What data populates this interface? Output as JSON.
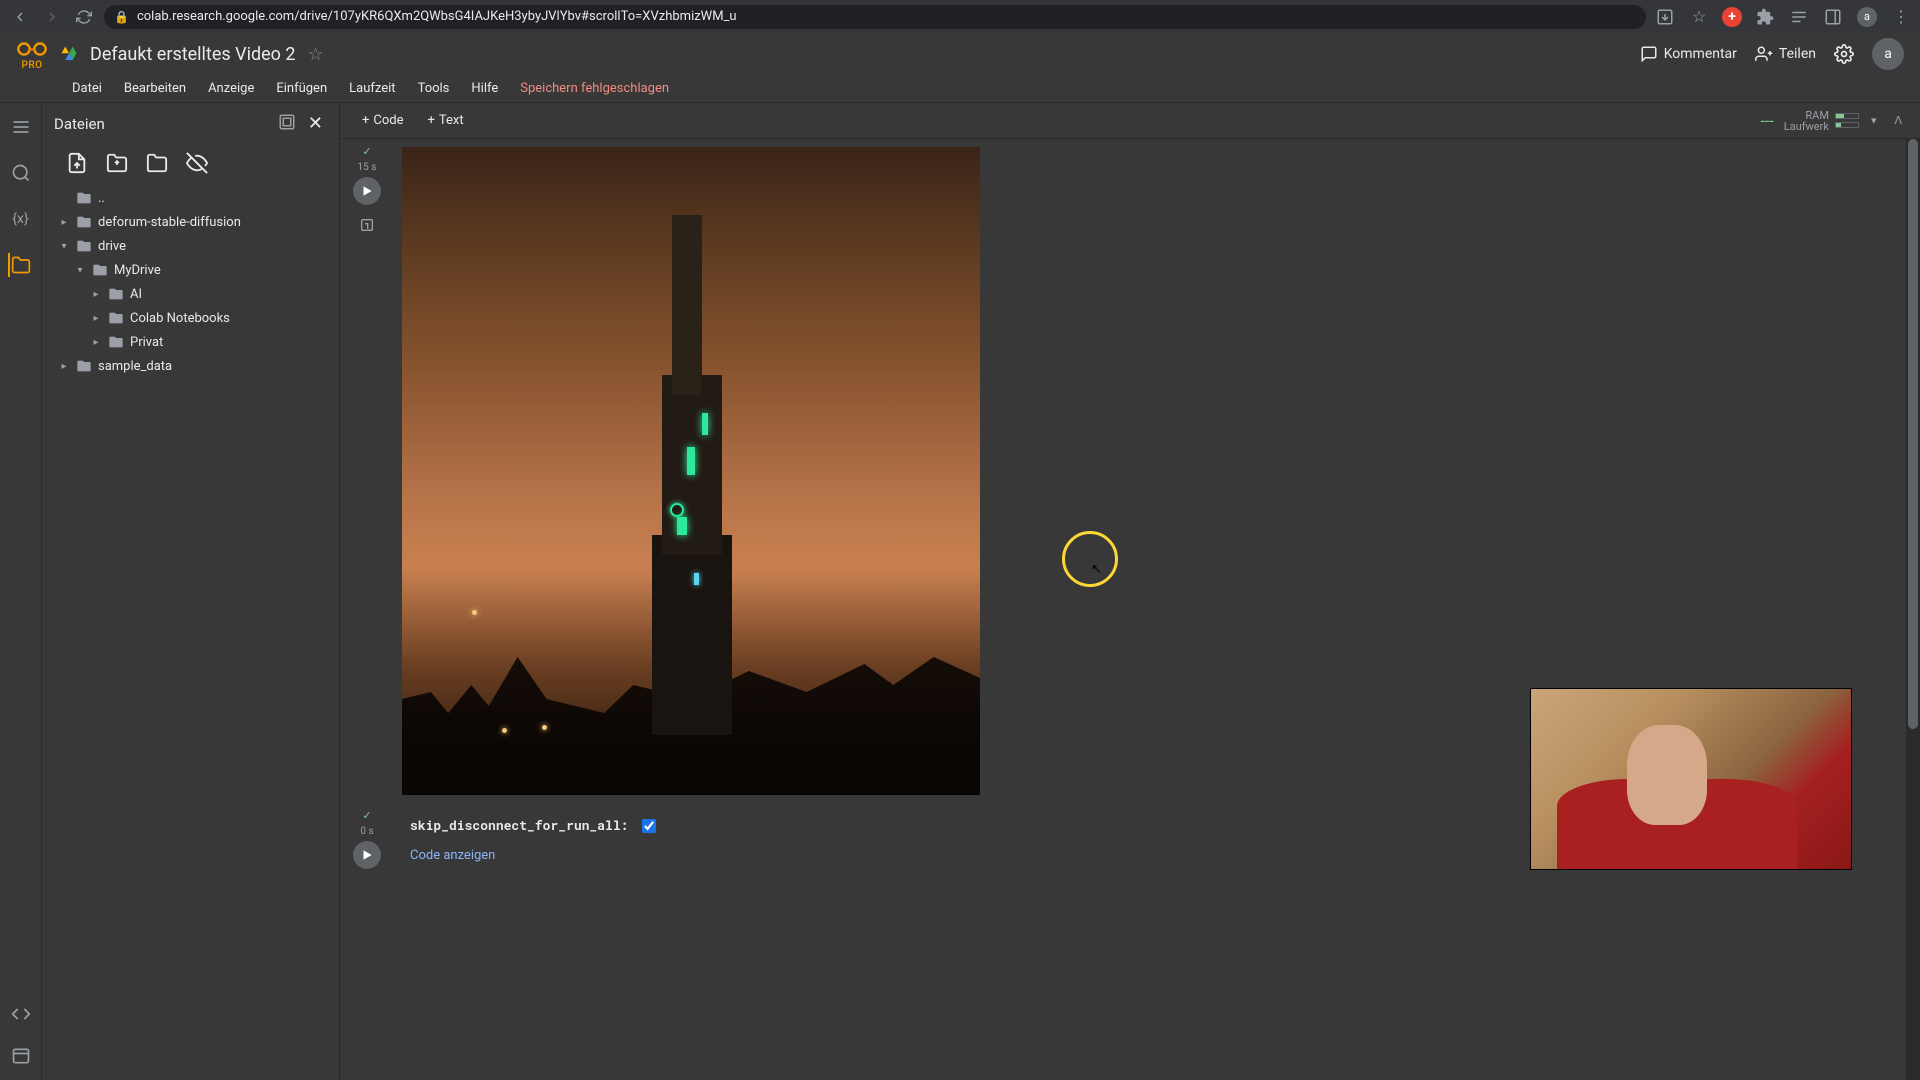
{
  "browser": {
    "url": "colab.research.google.com/drive/107yKR6QXm2QWbsG4IAJKeH3ybyJVlYbv#scrollTo=XVzhbmizWM_u"
  },
  "header": {
    "pro_badge": "PRO",
    "title": "Defaukt erstelltes Video 2",
    "comment": "Kommentar",
    "share": "Teilen",
    "avatar_letter": "a"
  },
  "menu": {
    "items": [
      "Datei",
      "Bearbeiten",
      "Anzeige",
      "Einfügen",
      "Laufzeit",
      "Tools",
      "Hilfe"
    ],
    "error": "Speichern fehlgeschlagen"
  },
  "file_panel": {
    "title": "Dateien",
    "tree": [
      {
        "label": "..",
        "depth": 0,
        "expandable": false
      },
      {
        "label": "deforum-stable-diffusion",
        "depth": 0,
        "expandable": true,
        "expanded": false
      },
      {
        "label": "drive",
        "depth": 0,
        "expandable": true,
        "expanded": true
      },
      {
        "label": "MyDrive",
        "depth": 1,
        "expandable": true,
        "expanded": true
      },
      {
        "label": "AI",
        "depth": 2,
        "expandable": true,
        "expanded": false
      },
      {
        "label": "Colab Notebooks",
        "depth": 2,
        "expandable": true,
        "expanded": false
      },
      {
        "label": "Privat",
        "depth": 2,
        "expandable": true,
        "expanded": false
      },
      {
        "label": "sample_data",
        "depth": 0,
        "expandable": true,
        "expanded": false
      }
    ]
  },
  "toolbar": {
    "add_code": "Code",
    "add_text": "Text"
  },
  "resources": {
    "ram_label": "RAM",
    "disk_label": "Laufwerk"
  },
  "cells": {
    "cell1_time": "15 s",
    "cell2_time": "0 s",
    "form_label": "skip_disconnect_for_run_all:",
    "show_code": "Code anzeigen",
    "checkbox_checked": true
  }
}
